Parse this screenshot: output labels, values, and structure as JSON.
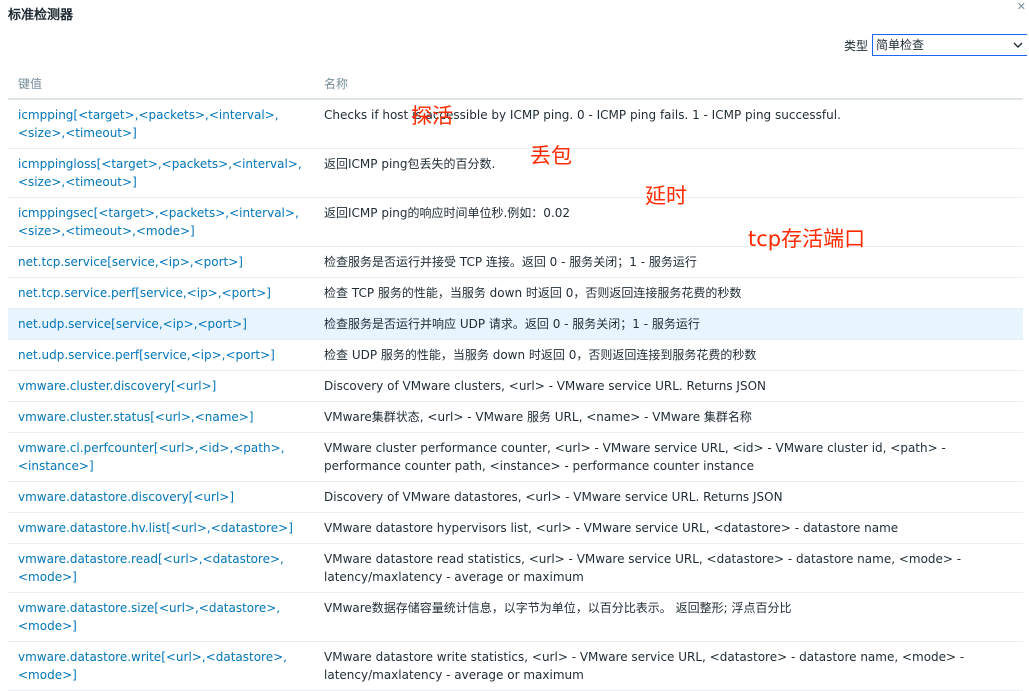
{
  "title": "标准检测器",
  "filter": {
    "label": "类型",
    "selected": "简单检查"
  },
  "table": {
    "headers": [
      "键值",
      "名称"
    ],
    "rows": [
      {
        "key": "icmpping[<target>,<packets>,<interval>,<size>,<timeout>]",
        "desc": "Checks if host is accessible by ICMP ping. 0 - ICMP ping fails. 1 - ICMP ping successful."
      },
      {
        "key": "icmppingloss[<target>,<packets>,<interval>,<size>,<timeout>]",
        "desc": "返回ICMP ping包丢失的百分数."
      },
      {
        "key": "icmppingsec[<target>,<packets>,<interval>,<size>,<timeout>,<mode>]",
        "desc": "返回ICMP ping的响应时间单位秒.例如：0.02"
      },
      {
        "key": "net.tcp.service[service,<ip>,<port>]",
        "desc": "检查服务是否运行并接受 TCP 连接。返回 0 - 服务关闭；1 - 服务运行"
      },
      {
        "key": "net.tcp.service.perf[service,<ip>,<port>]",
        "desc": "检查 TCP 服务的性能，当服务 down 时返回 0，否则返回连接服务花费的秒数"
      },
      {
        "key": "net.udp.service[service,<ip>,<port>]",
        "desc": "检查服务是否运行并响应 UDP 请求。返回 0 - 服务关闭；1 - 服务运行"
      },
      {
        "key": "net.udp.service.perf[service,<ip>,<port>]",
        "desc": "检查 UDP 服务的性能，当服务 down 时返回 0，否则返回连接到服务花费的秒数"
      },
      {
        "key": "vmware.cluster.discovery[<url>]",
        "desc": "Discovery of VMware clusters, <url> - VMware service URL. Returns JSON"
      },
      {
        "key": "vmware.cluster.status[<url>,<name>]",
        "desc": "VMware集群状态, <url> - VMware 服务 URL, <name> - VMware 集群名称"
      },
      {
        "key": "vmware.cl.perfcounter[<url>,<id>,<path>,<instance>]",
        "desc": "VMware cluster performance counter, <url> - VMware service URL, <id> - VMware cluster id, <path> - performance counter path, <instance> - performance counter instance"
      },
      {
        "key": "vmware.datastore.discovery[<url>]",
        "desc": "Discovery of VMware datastores, <url> - VMware service URL. Returns JSON"
      },
      {
        "key": "vmware.datastore.hv.list[<url>,<datastore>]",
        "desc": "VMware datastore hypervisors list, <url> - VMware service URL, <datastore> - datastore name"
      },
      {
        "key": "vmware.datastore.read[<url>,<datastore>,<mode>]",
        "desc": "VMware datastore read statistics, <url> - VMware service URL, <datastore> - datastore name, <mode> - latency/maxlatency - average or maximum"
      },
      {
        "key": "vmware.datastore.size[<url>,<datastore>,<mode>]",
        "desc": "VMware数据存储容量统计信息，以字节为单位，以百分比表示。 返回整形; 浮点百分比"
      },
      {
        "key": "vmware.datastore.write[<url>,<datastore>,<mode>]",
        "desc": "VMware datastore write statistics, <url> - VMware service URL, <datastore> - datastore name, <mode> - latency/maxlatency - average or maximum"
      }
    ]
  },
  "annotations": [
    "探活",
    "丢包",
    "延时",
    "tcp存活端口"
  ],
  "colors": {
    "link": "#0275b8",
    "annotation": "#ff2a00",
    "highlight": "#e8f5ff",
    "select_border": "#1f65f4"
  },
  "icons": {
    "close": "close-icon",
    "dropdown": "chevron-down-icon"
  }
}
